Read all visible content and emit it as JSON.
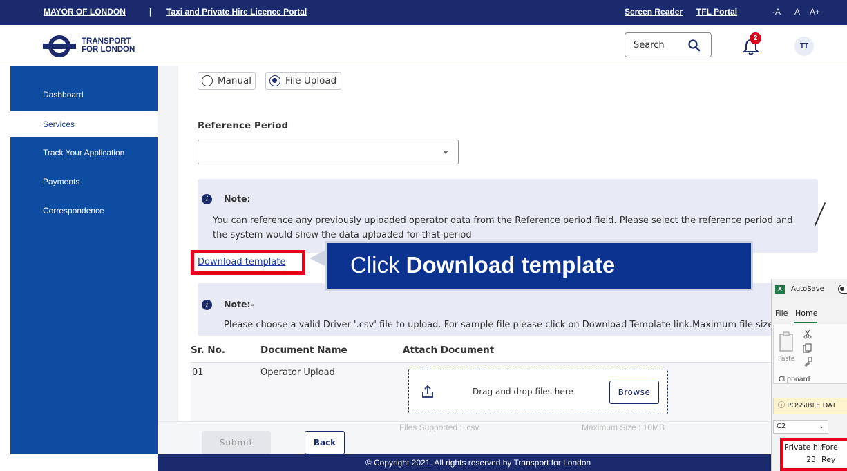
{
  "topbar": {
    "mayor": "MAYOR OF LONDON",
    "separator": "|",
    "portal_title": "Taxi and Private Hire Licence Portal",
    "screen_reader": "Screen Reader",
    "tfl_portal": "TFL Portal",
    "font_small": "-A",
    "font_normal": "A",
    "font_large": "A+"
  },
  "header": {
    "logo_line1": "TRANSPORT",
    "logo_line2": "FOR LONDON",
    "search_placeholder": "Search",
    "notifications_count": "2",
    "avatar_initials": "TT"
  },
  "sidebar": {
    "items": [
      {
        "label": "Dashboard",
        "active": false
      },
      {
        "label": "Services",
        "active": true
      },
      {
        "label": "Track Your Application",
        "active": false
      },
      {
        "label": "Payments",
        "active": false
      },
      {
        "label": "Correspondence",
        "active": false
      }
    ]
  },
  "form": {
    "mode_options": [
      "Manual",
      "File Upload"
    ],
    "selected_mode": "File Upload",
    "reference_period_label": "Reference Period",
    "reference_period_value": "",
    "note1_title": "Note:",
    "note1_line1": "You can reference any previously uploaded operator data from the Reference period field. Please select the reference period and",
    "note1_line2": "the system would show the data uploaded for that period",
    "download_template": "Download template",
    "note2_title": "Note:-",
    "note2_text": "Please choose a valid Driver '.csv' file to upload. For sample file please click on Download Template link.Maximum file size i",
    "table": {
      "headers": [
        "Sr. No.",
        "Document Name",
        "Attach Document"
      ],
      "rows": [
        {
          "sr": "01",
          "name": "Operator Upload"
        }
      ]
    },
    "dropzone_text": "Drag and drop files here",
    "browse_label": "Browse",
    "files_supported": "Files Supported : .csv",
    "max_size": "Maximum Size : 10MB",
    "submit_label": "Submit",
    "back_label": "Back"
  },
  "footer": {
    "copyright": "© Copyright 2021. All rights reserved by Transport for London"
  },
  "callout": {
    "prefix": "Click ",
    "bold": "Download template"
  },
  "excel": {
    "autosave": "AutoSave",
    "menu_file": "File",
    "menu_home": "Home",
    "paste": "Paste",
    "clipboard": "Clipboard",
    "warning": "POSSIBLE DAT",
    "namebox": "C2",
    "cell_header_a": "Private hir",
    "cell_header_b": "Fore",
    "cell_value_a": "23",
    "cell_value_b": "Rey"
  },
  "colors": {
    "navy": "#1a2a6c",
    "sidebar_blue": "#0d4ca1",
    "highlight_red": "#e8001c",
    "callout_blue": "#0d3391",
    "badge_red": "#d6001c"
  }
}
